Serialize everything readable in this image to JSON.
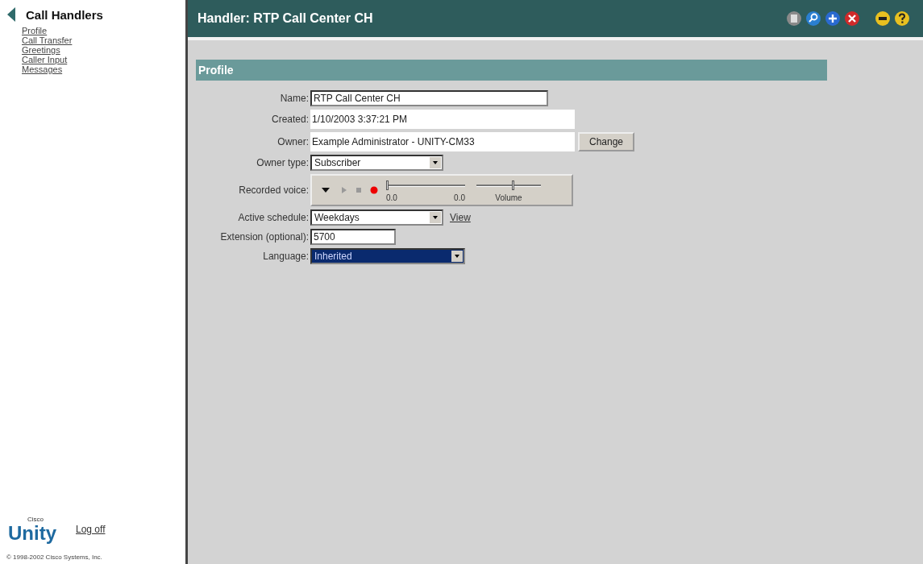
{
  "sidebar": {
    "title": "Call Handlers",
    "items": [
      {
        "label": "Profile"
      },
      {
        "label": "Call Transfer"
      },
      {
        "label": "Greetings"
      },
      {
        "label": "Caller Input"
      },
      {
        "label": "Messages"
      }
    ],
    "logo_small": "Cisco",
    "logo": "Unity",
    "logoff": "Log off",
    "copyright": "© 1998-2002 Cisco Systems, Inc."
  },
  "header": {
    "title": "Handler: RTP Call Center CH"
  },
  "section": {
    "title": "Profile"
  },
  "fields": [
    {
      "kind": "input",
      "label": "Name:",
      "value": "RTP Call Center CH"
    },
    {
      "kind": "readonly",
      "label": "Created:",
      "value": "1/10/2003 3:37:21 PM"
    },
    {
      "kind": "readonly",
      "label": "Owner:",
      "value": "Example Administrator - UNITY-CM33",
      "button": "Change"
    },
    {
      "kind": "select",
      "label": "Owner type:",
      "value": "Subscriber",
      "focused": false
    },
    {
      "kind": "recorder",
      "label": "Recorded voice:",
      "position": {
        "level": 0.0,
        "reading": "0.0"
      },
      "length": "0.0",
      "volume": {
        "level": 0.55,
        "reading": "Volume"
      }
    },
    {
      "kind": "select",
      "label": "Active schedule:",
      "value": "Weekdays",
      "link": "View",
      "focused": false
    },
    {
      "kind": "short-input",
      "label": "Extension (optional):",
      "value": "5700"
    },
    {
      "kind": "select",
      "label": "Language:",
      "value": "Inherited",
      "focused": true
    }
  ]
}
